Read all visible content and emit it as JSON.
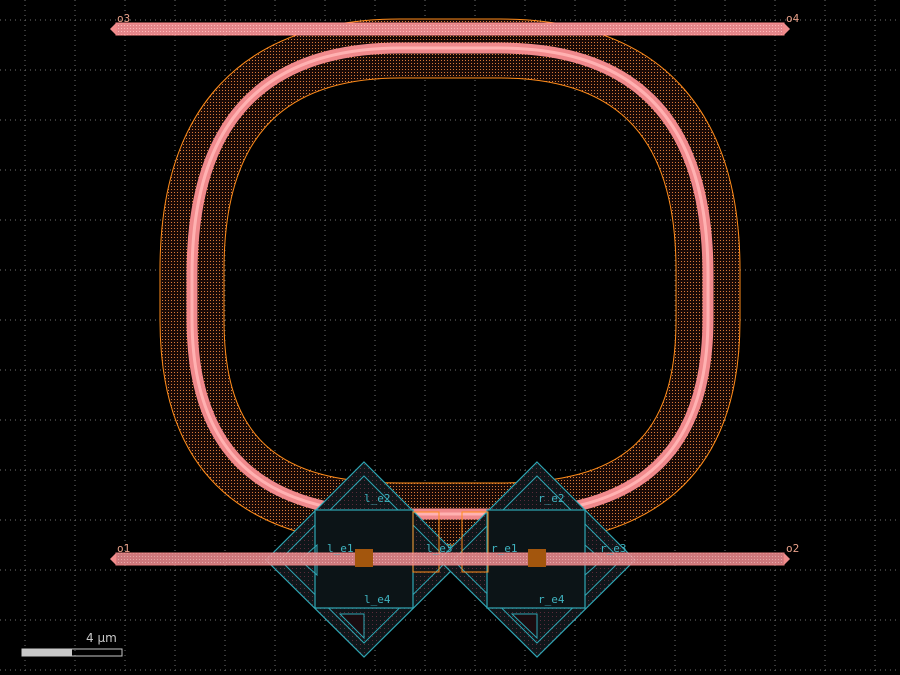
{
  "ports": {
    "o1": "o1",
    "o2": "o2",
    "o3": "o3",
    "o4": "o4"
  },
  "heater_ports": {
    "l_e1": "l_e1",
    "l_e2": "l_e2",
    "l_e3": "l_e3",
    "l_e4": "l_e4",
    "r_e1": "r_e1",
    "r_e2": "r_e2",
    "r_e3": "r_e3",
    "r_e4": "r_e4"
  },
  "scale_bar": {
    "label": "4 μm"
  },
  "colors": {
    "background": "#000000",
    "waveguide": "#f08c8c",
    "cladding_outline": "#ff8c1a",
    "metal_outline": "#2fa6b4",
    "via": "#a3560d",
    "grid": "#6f6f6f"
  }
}
